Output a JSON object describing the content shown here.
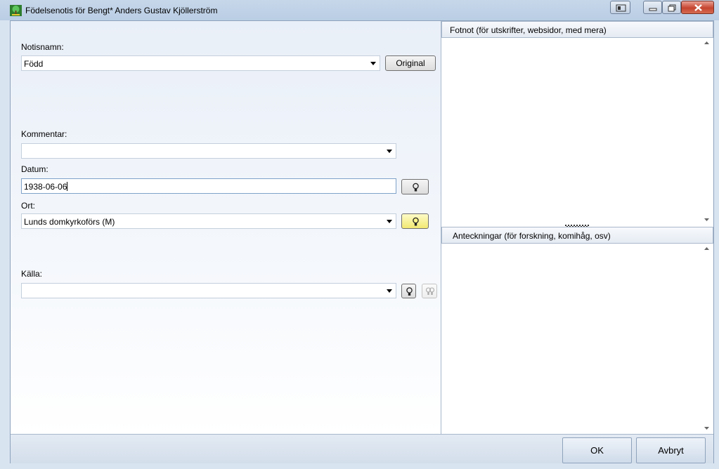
{
  "window": {
    "title": "Födelsenotis för Bengt* Anders Gustav Kjöllerström"
  },
  "form": {
    "notisnamn": {
      "label": "Notisnamn:",
      "value": "Född",
      "button": "Original"
    },
    "kommentar": {
      "label": "Kommentar:",
      "value": ""
    },
    "datum": {
      "label": "Datum:",
      "value": "1938-06-06"
    },
    "ort": {
      "label": "Ort:",
      "value": "Lunds domkyrkoförs (M)"
    },
    "kalla": {
      "label": "Källa:",
      "value": ""
    }
  },
  "right": {
    "fotnot_header": "Fotnot (för utskrifter, websidor, med mera)",
    "anteckningar_header": "Anteckningar (för forskning, komihåg, osv)"
  },
  "buttons": {
    "ok": "OK",
    "cancel": "Avbryt"
  },
  "colors": {
    "bulb_active": "#f2e973",
    "close_button": "#c5452f"
  }
}
